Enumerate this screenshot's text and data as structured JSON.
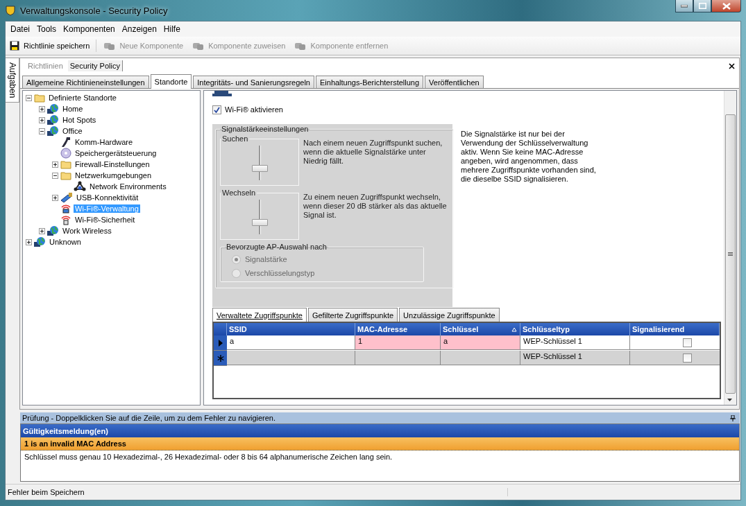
{
  "window": {
    "title": "Verwaltungskonsole - Security Policy"
  },
  "menu": [
    "Datei",
    "Tools",
    "Komponenten",
    "Anzeigen",
    "Hilfe"
  ],
  "toolbar": [
    {
      "kind": "save",
      "label": "Richtlinie speichern",
      "disabled": false
    },
    {
      "kind": "add",
      "label": "Neue Komponente",
      "disabled": true
    },
    {
      "kind": "assign",
      "label": "Komponente zuweisen",
      "disabled": true
    },
    {
      "kind": "remove",
      "label": "Komponente entfernen",
      "disabled": true
    }
  ],
  "side_tab": "Aufgaben",
  "breadcrumb": [
    {
      "label": "Richtlinien",
      "selected": false
    },
    {
      "label": "Security Policy",
      "selected": true
    }
  ],
  "tabs": [
    {
      "label": "Allgemeine Richtinieneinstellungen",
      "selected": false
    },
    {
      "label": "Standorte",
      "selected": true
    },
    {
      "label": "Integritäts- und Sanierungsregeln",
      "selected": false
    },
    {
      "label": "Einhaltungs-Berichterstellung",
      "selected": false
    },
    {
      "label": "Veröffentlichen",
      "selected": false
    }
  ],
  "tree": [
    {
      "kind": "folder",
      "label": "Definierte Standorte",
      "expanded": true,
      "selected": false,
      "children": [
        {
          "kind": "globe",
          "label": "Home",
          "expanded": false,
          "selected": false
        },
        {
          "kind": "globe",
          "label": "Hot Spots",
          "expanded": false,
          "selected": false
        },
        {
          "kind": "globe",
          "label": "Office",
          "expanded": true,
          "selected": false,
          "children": [
            {
              "kind": "hardware",
              "label": "Komm-Hardware",
              "selected": false
            },
            {
              "kind": "disc",
              "label": "Speichergerätsteuerung",
              "selected": false
            },
            {
              "kind": "folder",
              "label": "Firewall-Einstellungen",
              "expanded": false,
              "selected": false
            },
            {
              "kind": "folder",
              "label": "Netzwerkumgebungen",
              "expanded": true,
              "selected": false,
              "children": [
                {
                  "kind": "network",
                  "label": "Network Environments",
                  "selected": false
                }
              ]
            },
            {
              "kind": "usb",
              "label": "USB-Konnektivität",
              "expanded": false,
              "selected": false
            },
            {
              "kind": "wifi",
              "label": "Wi-Fi®-Verwaltung",
              "selected": true
            },
            {
              "kind": "wifilock",
              "label": "Wi-Fi®-Sicherheit",
              "selected": false
            }
          ]
        },
        {
          "kind": "globe",
          "label": "Work Wireless",
          "expanded": false,
          "selected": false
        }
      ]
    },
    {
      "kind": "globe",
      "label": "Unknown",
      "expanded": false,
      "selected": false
    }
  ],
  "wifi_enable": {
    "label": "Wi-Fi® aktivieren",
    "checked": true
  },
  "signal_settings": {
    "title": "Signalstärkeeinstellungen",
    "sliders": [
      {
        "title": "Suchen",
        "level": 0.3,
        "description": "Nach einem neuen Zugriffspunkt suchen, wenn die aktuelle Signalstärke unter Niedrig fällt."
      },
      {
        "title": "Wechseln",
        "level": 0.3,
        "description": "Zu einem neuen Zugriffspunkt wechseln, wenn dieser 20 dB stärker als das aktuelle Signal ist."
      }
    ],
    "preference": {
      "title": "Bevorzugte AP-Auswahl nach",
      "disabled": true,
      "options": [
        {
          "label": "Signalstärke",
          "selected": true
        },
        {
          "label": "Verschlüsselungstyp",
          "selected": false
        }
      ]
    }
  },
  "info_text": "Die Signalstärke ist nur bei der Verwendung der Schlüsselverwaltung aktiv. Wenn Sie keine MAC-Adresse angeben, wird angenommen, dass mehrere Zugriffspunkte vorhanden sind, die dieselbe SSID signalisieren.",
  "ap_tabs": [
    {
      "label": "Verwaltete Zugriffspunkte",
      "selected": true
    },
    {
      "label": "Gefilterte Zugriffspunkte",
      "selected": false
    },
    {
      "label": "Unzulässige Zugriffspunkte",
      "selected": false
    }
  ],
  "ap_table": {
    "columns": [
      {
        "label": "SSID",
        "sorted": false
      },
      {
        "label": "MAC-Adresse",
        "sorted": false
      },
      {
        "label": "Schlüssel",
        "sorted": true
      },
      {
        "label": "Schlüsseltyp",
        "sorted": false
      },
      {
        "label": "Signalisierend",
        "sorted": false
      }
    ],
    "rows": [
      {
        "kind": "current",
        "signaling": false,
        "cells": [
          {
            "text": "a",
            "error": false
          },
          {
            "text": "1",
            "error": true
          },
          {
            "text": "a",
            "error": true
          },
          {
            "text": "WEP-Schlüssel 1",
            "error": false
          }
        ]
      },
      {
        "kind": "new",
        "signaling": false,
        "cells": [
          {
            "text": "",
            "error": false
          },
          {
            "text": "",
            "error": false
          },
          {
            "text": "",
            "error": false
          },
          {
            "text": "WEP-Schlüssel 1",
            "error": false
          }
        ]
      }
    ]
  },
  "validation": {
    "title": "Prüfung - Doppelklicken Sie auf die Zeile, um zu dem Fehler zu navigieren.",
    "column": "Gültigkeitsmeldung(en)",
    "rows": [
      {
        "text": "1 is an invalid MAC Address",
        "selected": true
      },
      {
        "text": "Schlüssel muss genau 10 Hexadezimal-, 26 Hexadezimal- oder 8 bis 64 alphanumerische Zeichen lang sein.",
        "selected": false
      }
    ]
  },
  "status_bar": "Fehler beim Speichern"
}
